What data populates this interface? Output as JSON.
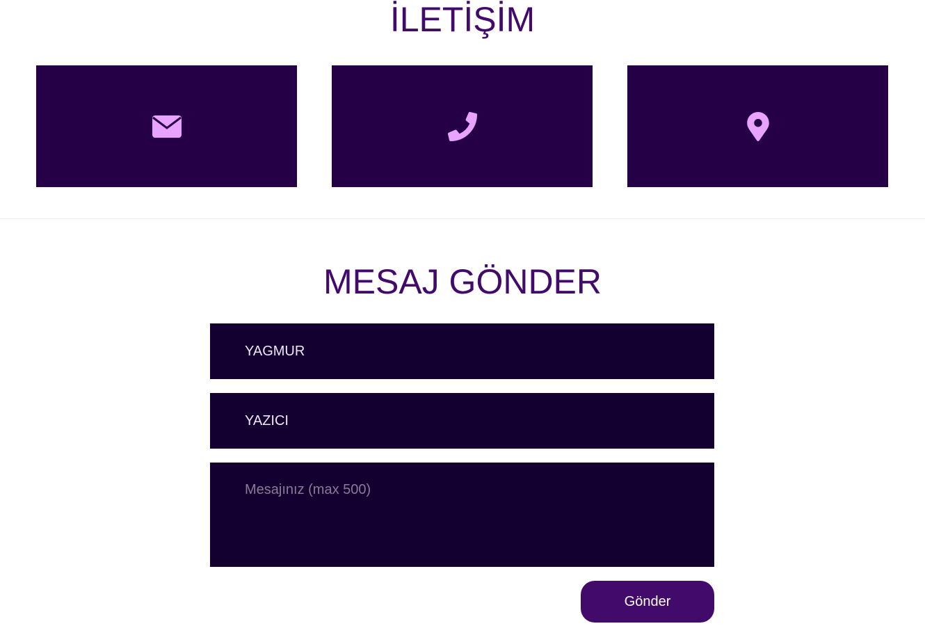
{
  "contact": {
    "title": "İLETİŞİM",
    "cards": [
      {
        "icon": "envelope-icon"
      },
      {
        "icon": "phone-icon"
      },
      {
        "icon": "map-marker-icon"
      }
    ]
  },
  "message_form": {
    "title": "MESAJ GÖNDER",
    "first_name_value": "YAGMUR",
    "last_name_value": "YAZICI",
    "message_placeholder": "Mesajınız (max 500)",
    "submit_label": "Gönder"
  },
  "colors": {
    "heading": "#410a6b",
    "card_background": "#260046",
    "icon": "#e8a3ff",
    "field_background": "#130030",
    "button_background": "#410a6b"
  }
}
